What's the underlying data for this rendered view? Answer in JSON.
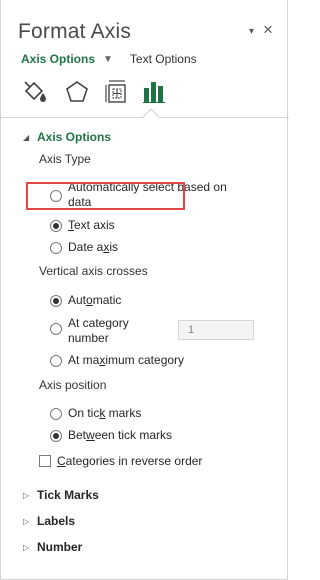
{
  "pane": {
    "title": "Format Axis",
    "close_glyph": "×",
    "dropdown_glyph": "▾"
  },
  "tabs": {
    "primary": "Axis Options",
    "caret": "▼",
    "secondary": "Text Options"
  },
  "icons": [
    {
      "name": "fill-line-icon"
    },
    {
      "name": "effects-icon"
    },
    {
      "name": "size-properties-icon"
    },
    {
      "name": "axis-options-icon",
      "selected": true
    }
  ],
  "axis_options": {
    "header": "Axis Options",
    "axis_type": {
      "label": "Axis Type",
      "auto_line1": "Automatically select based on",
      "auto_line2": "data",
      "text_pre": "",
      "text_u": "T",
      "text_post": "ext axis",
      "date_pre": "Date a",
      "date_u": "x",
      "date_post": "is",
      "selected": "text"
    },
    "vertical_crosses": {
      "label": "Vertical axis crosses",
      "automatic_pre": "Aut",
      "automatic_u": "o",
      "automatic_post": "matic",
      "at_category_pre": "At cate",
      "at_category_u": "g",
      "at_category_post": "ory",
      "at_category_line2": "number",
      "at_category_value": "1",
      "at_max_pre": "At ma",
      "at_max_u": "x",
      "at_max_post": "imum category",
      "selected": "automatic"
    },
    "axis_position": {
      "label": "Axis position",
      "tick_pre": "On tic",
      "tick_u": "k",
      "tick_post": " marks",
      "between_pre": "Bet",
      "between_u": "w",
      "between_post": "een tick marks",
      "selected": "between"
    },
    "reverse": {
      "pre": "",
      "u": "C",
      "post": "ategories in reverse order",
      "checked": false
    }
  },
  "sections": {
    "tick_marks": "Tick Marks",
    "labels": "Labels",
    "number": "Number"
  },
  "colors": {
    "accent": "#217346",
    "highlight": "#e04646"
  }
}
